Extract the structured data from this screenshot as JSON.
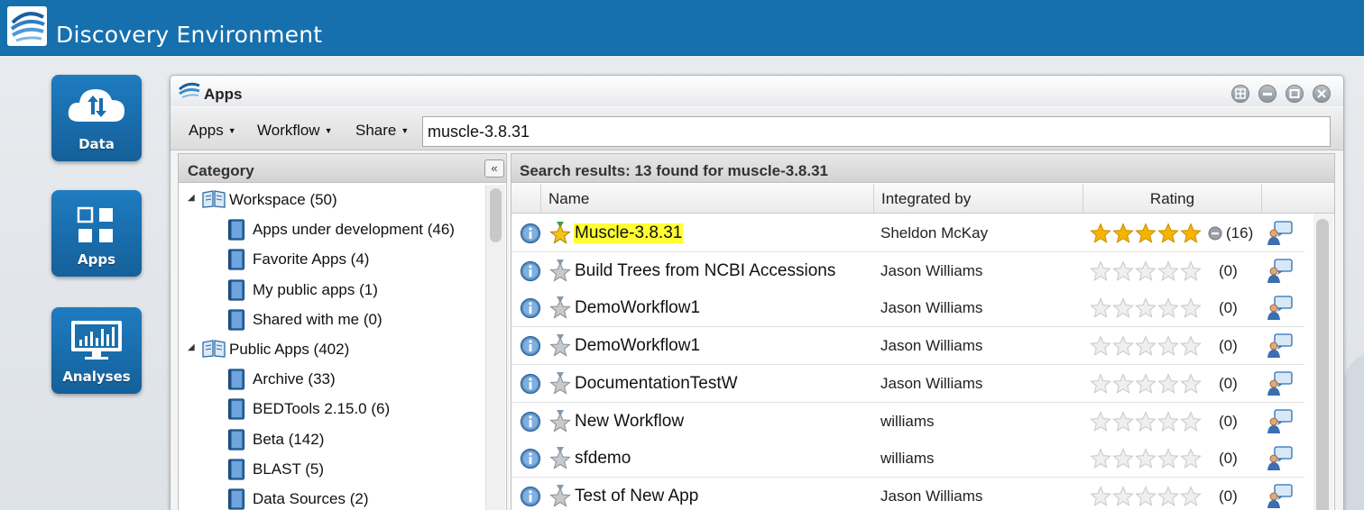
{
  "header": {
    "title": "Discovery Environment"
  },
  "shortcuts": [
    {
      "label": "Data",
      "icon": "cloud-transfer-icon"
    },
    {
      "label": "Apps",
      "icon": "app-grid-icon"
    },
    {
      "label": "Analyses",
      "icon": "monitor-chart-icon"
    }
  ],
  "window": {
    "title": "Apps",
    "controls": [
      "layout-icon",
      "minimize-icon",
      "maximize-icon",
      "close-icon"
    ]
  },
  "toolbar": {
    "apps_label": "Apps",
    "workflow_label": "Workflow",
    "share_label": "Share",
    "search_value": "muscle-3.8.31"
  },
  "category": {
    "title": "Category",
    "collapse_label": "«",
    "items": [
      {
        "label": "Workspace (50)",
        "level": 0,
        "expanded": true
      },
      {
        "label": "Apps under development (46)",
        "level": 1
      },
      {
        "label": "Favorite Apps (4)",
        "level": 1
      },
      {
        "label": "My public apps (1)",
        "level": 1
      },
      {
        "label": "Shared with me (0)",
        "level": 1
      },
      {
        "label": "Public Apps (402)",
        "level": 0,
        "expanded": true
      },
      {
        "label": "Archive (33)",
        "level": 1
      },
      {
        "label": "BEDTools 2.15.0 (6)",
        "level": 1
      },
      {
        "label": "Beta (142)",
        "level": 1
      },
      {
        "label": "BLAST (5)",
        "level": 1
      },
      {
        "label": "Data Sources (2)",
        "level": 1
      }
    ]
  },
  "results": {
    "summary": "Search results: 13 found for muscle-3.8.31",
    "columns": {
      "name": "Name",
      "integrated_by": "Integrated by",
      "rating": "Rating"
    },
    "rows": [
      {
        "name": "Muscle-3.8.31",
        "integrated_by": "Sheldon McKay",
        "rating": 5,
        "count": "(16)",
        "favorite": true,
        "highlight": true,
        "rated": true
      },
      {
        "name": "Build Trees from NCBI Accessions",
        "integrated_by": "Jason Williams",
        "rating": 0,
        "count": "(0)",
        "favorite": false
      },
      {
        "name": "DemoWorkflow1",
        "integrated_by": "Jason Williams",
        "rating": 0,
        "count": "(0)",
        "favorite": false
      },
      {
        "name": "DemoWorkflow1",
        "integrated_by": "Jason Williams",
        "rating": 0,
        "count": "(0)",
        "favorite": false
      },
      {
        "name": "DocumentationTestW",
        "integrated_by": "Jason Williams",
        "rating": 0,
        "count": "(0)",
        "favorite": false
      },
      {
        "name": "New Workflow",
        "integrated_by": "williams",
        "rating": 0,
        "count": "(0)",
        "favorite": false
      },
      {
        "name": "sfdemo",
        "integrated_by": "williams",
        "rating": 0,
        "count": "(0)",
        "favorite": false
      },
      {
        "name": "Test of New App",
        "integrated_by": "Jason Williams",
        "rating": 0,
        "count": "(0)",
        "favorite": false
      }
    ]
  },
  "colors": {
    "brand_blue": "#1670ad",
    "highlight": "#ffff33",
    "star_gold": "#f5b400",
    "star_empty": "#d8d8d8"
  }
}
